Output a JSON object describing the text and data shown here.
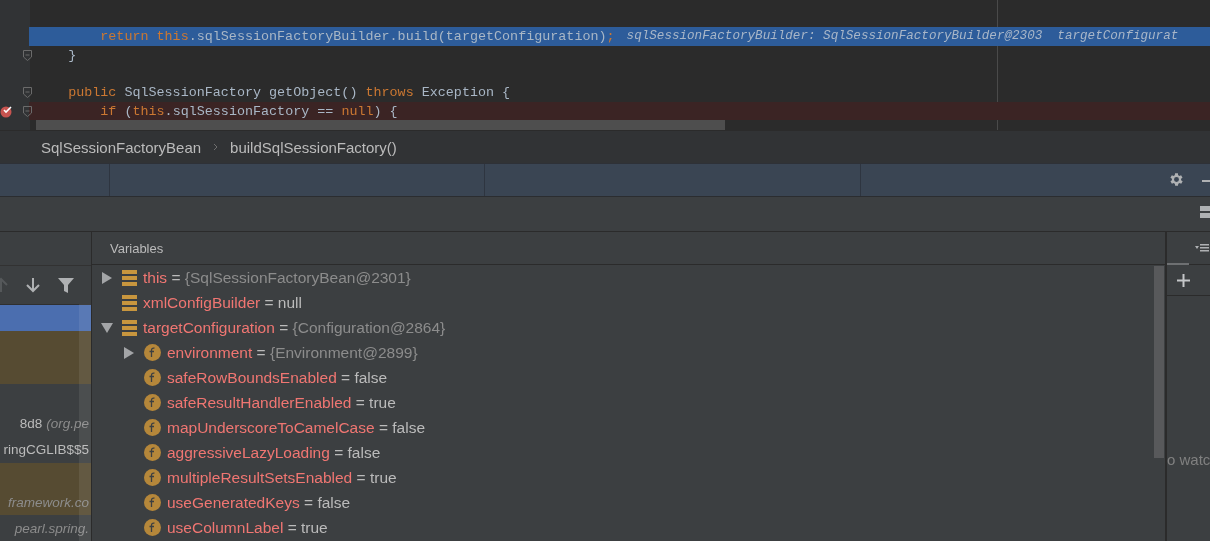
{
  "editor": {
    "lines": [
      {
        "current": true,
        "breakpoint": false,
        "fold_marker": false,
        "gap_before": false,
        "tokens": [
          {
            "kind": "keyword",
            "text": "        return this"
          },
          {
            "kind": "plain",
            "text": ".sqlSessionFactoryBuilder.build(targetConfiguration)"
          },
          {
            "kind": "keyword",
            "text": ";"
          }
        ],
        "inline_values": "sqlSessionFactoryBuilder: SqlSessionFactoryBuilder@2303  targetConfigurat"
      },
      {
        "current": false,
        "breakpoint": false,
        "fold_marker": true,
        "gap_before": false,
        "tokens": [
          {
            "kind": "plain",
            "text": "    }"
          }
        ]
      },
      {
        "current": false,
        "breakpoint": false,
        "fold_marker": true,
        "gap_before": true,
        "tokens": [
          {
            "kind": "keyword",
            "text": "    public"
          },
          {
            "kind": "plain",
            "text": " SqlSessionFactory getObject() "
          },
          {
            "kind": "keyword",
            "text": "throws"
          },
          {
            "kind": "plain",
            "text": " Exception {"
          }
        ]
      },
      {
        "current": false,
        "breakpoint": true,
        "fold_marker": true,
        "gap_before": false,
        "tokens": [
          {
            "kind": "keyword",
            "text": "        if"
          },
          {
            "kind": "plain",
            "text": " ("
          },
          {
            "kind": "keyword",
            "text": "this"
          },
          {
            "kind": "plain",
            "text": ".sqlSessionFactory == "
          },
          {
            "kind": "keyword",
            "text": "null"
          },
          {
            "kind": "plain",
            "text": ") {"
          }
        ]
      }
    ]
  },
  "breadcrumbs": [
    "SqlSessionFactoryBean",
    "buildSqlSessionFactory()"
  ],
  "frames": {
    "up_disabled": true,
    "rows": [
      {
        "selected": true,
        "library": false
      },
      {
        "selected": false,
        "library": true
      },
      {
        "selected": false,
        "library": true
      },
      {
        "selected": false,
        "library": false
      },
      {
        "selected": false,
        "library": false,
        "text": "8d8",
        "detail": "(org.pe"
      },
      {
        "selected": false,
        "library": false,
        "text": "ringCGLIB$$5"
      },
      {
        "selected": false,
        "library": true
      },
      {
        "selected": false,
        "library": true,
        "detail": "framework.co"
      },
      {
        "selected": false,
        "library": false,
        "detail": "pearl.spring."
      }
    ]
  },
  "variables": {
    "title": "Variables",
    "items": [
      {
        "kind": "local",
        "name": "this",
        "assign": "=",
        "value": "{SqlSessionFactoryBean@2301}",
        "object": true,
        "expanded": false
      },
      {
        "kind": "local",
        "name": "xmlConfigBuilder",
        "assign": "=",
        "value": "null",
        "object": false
      },
      {
        "kind": "local",
        "name": "targetConfiguration",
        "assign": "=",
        "value": "{Configuration@2864}",
        "object": true,
        "expanded": true,
        "children": [
          {
            "kind": "field",
            "name": "environment",
            "assign": "=",
            "value": "{Environment@2899}",
            "object": true,
            "expanded": false
          },
          {
            "kind": "field",
            "name": "safeRowBoundsEnabled",
            "assign": "=",
            "value": "false",
            "object": false
          },
          {
            "kind": "field",
            "name": "safeResultHandlerEnabled",
            "assign": "=",
            "value": "true",
            "object": false
          },
          {
            "kind": "field",
            "name": "mapUnderscoreToCamelCase",
            "assign": "=",
            "value": "false",
            "object": false
          },
          {
            "kind": "field",
            "name": "aggressiveLazyLoading",
            "assign": "=",
            "value": "false",
            "object": false
          },
          {
            "kind": "field",
            "name": "multipleResultSetsEnabled",
            "assign": "=",
            "value": "true",
            "object": false
          },
          {
            "kind": "field",
            "name": "useGeneratedKeys",
            "assign": "=",
            "value": "false",
            "object": false
          },
          {
            "kind": "field",
            "name": "useColumnLabel",
            "assign": "=",
            "value": "true",
            "object": false
          }
        ]
      }
    ]
  },
  "watches": {
    "empty_text": "o watc"
  }
}
